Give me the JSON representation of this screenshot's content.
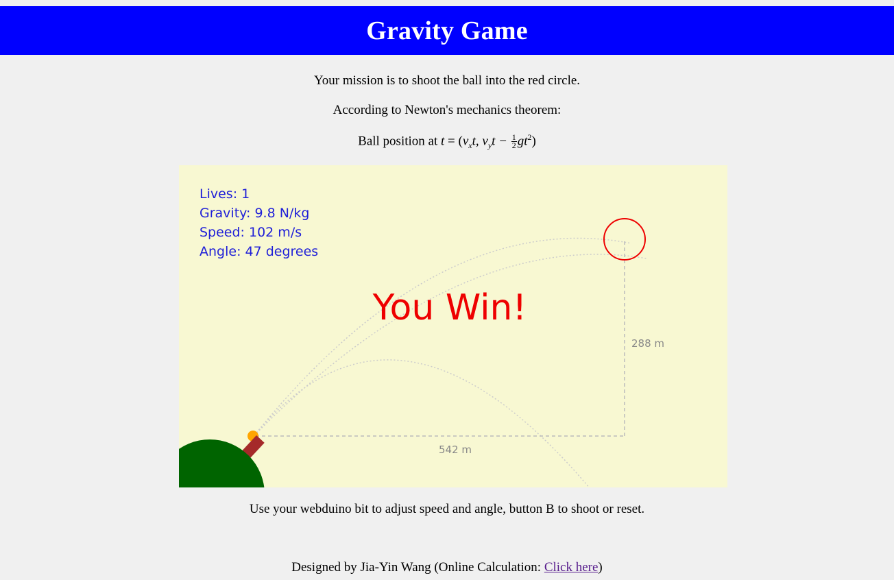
{
  "header": {
    "title": "Gravity Game"
  },
  "intro": {
    "mission": "Your mission is to shoot the ball into the red circle.",
    "theorem": "According to Newton's mechanics theorem:",
    "formula_prefix": "Ball position at ",
    "formula_t": "t",
    "formula_eq": " = (",
    "formula_vx": "v",
    "formula_x_sub": "x",
    "formula_t1": "t, ",
    "formula_vy": "v",
    "formula_y_sub": "y",
    "formula_t2": "t − ",
    "formula_half_num": "1",
    "formula_half_den": "2",
    "formula_gt": "gt",
    "formula_sq": "2",
    "formula_close": ")"
  },
  "game": {
    "stats": {
      "lives": "Lives: 1",
      "gravity": "Gravity: 9.8 N/kg",
      "speed": "Speed: 102 m/s",
      "angle": "Angle: 47 degrees"
    },
    "status_message": "You Win!",
    "horizontal_distance": "542 m",
    "vertical_distance": "288 m",
    "colors": {
      "background": "#f8f8d2",
      "ground": "#006400",
      "cannon": "#a52a2a",
      "ball": "#ffa500",
      "target": "#ee0000",
      "stats_text": "#2020d8"
    },
    "icons": {
      "cannon": "cannon-icon",
      "ball": "ball-icon",
      "target": "target-circle-icon",
      "ground": "hill-icon"
    }
  },
  "instructions": "Use your webduino bit to adjust speed and angle, button B to shoot or reset.",
  "footer": {
    "credit_prefix": "Designed by Jia-Yin Wang (Online Calculation: ",
    "link_label": "Click here",
    "credit_suffix": ")"
  }
}
